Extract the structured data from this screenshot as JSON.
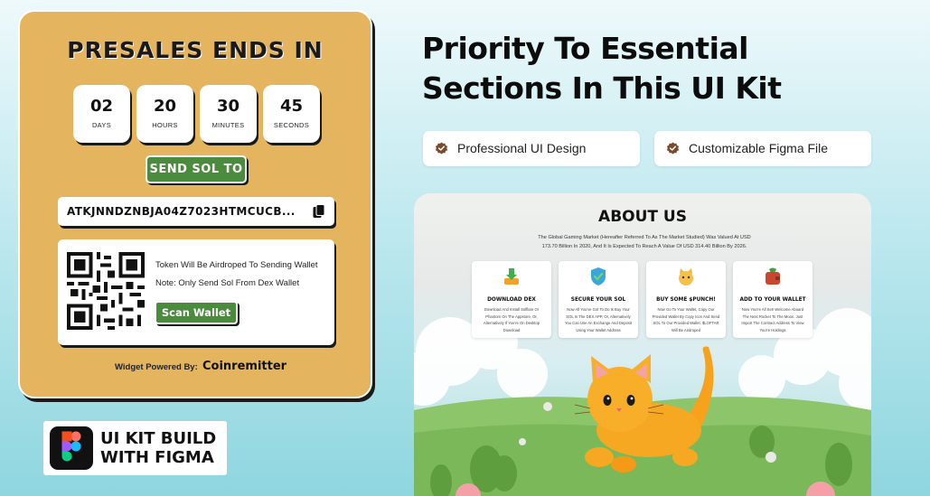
{
  "widget": {
    "title": "PRESALES ENDS IN",
    "countdown": [
      {
        "value": "02",
        "label": "DAYS"
      },
      {
        "value": "20",
        "label": "HOURS"
      },
      {
        "value": "30",
        "label": "MINUTES"
      },
      {
        "value": "45",
        "label": "SECONDS"
      }
    ],
    "send_button": "SEND SOL TO",
    "address": "ATKJNNDZNBJA04Z7023HTMCUCB...",
    "qr_note_1": "Token Will Be Airdroped To Sending Wallet",
    "qr_note_2": "Note: Only Send Sol From Dex Wallet",
    "scan_button": "Scan Wallet",
    "powered_by": "Widget Powered By:",
    "brand": "Coinremitter",
    "colors": {
      "panel": "#e5b45f",
      "button": "#4b8b3d"
    }
  },
  "figma_badge": {
    "line1": "UI KIT BUILD",
    "line2": "WITH FIGMA",
    "icon": "figma-logo-icon"
  },
  "headline": {
    "line1": "Priority To Essential",
    "line2": "Sections In This UI Kit"
  },
  "chips": [
    {
      "label": "Professional UI Design",
      "icon": "check-badge-icon"
    },
    {
      "label": "Customizable Figma File",
      "icon": "check-badge-icon"
    }
  ],
  "about": {
    "title": "ABOUT US",
    "desc": "The Global Gaming Market (Hereafter Referred To As The Market Studied) Was Valued At USD 173.70 Billion In 2020, And It Is Expected To Reach A Value Of USD 314.40 Billion By 2026.",
    "features": [
      {
        "title": "DOWNLOAD DEX",
        "text": "Download And Install Solflare Or Phantom On The Appstore, Or, Alternatively If You're On Desktop Download",
        "icon": "download-icon"
      },
      {
        "title": "SECURE YOUR SOL",
        "text": "Now All You've Got To Do Is Buy Your SOL In The DEX APP, Or, Alternatively You Can Use An Exchange And Deposit Using Your Wallet Address",
        "icon": "shield-check-icon"
      },
      {
        "title": "BUY SOME $PUNCH!",
        "text": "Now Go To Your Wallet, Copy Our Provided Wallet By Copy Icon And Send SOL To Our Provided Wallet. $LOFTAR Will Be Airdroped",
        "icon": "cat-coin-icon"
      },
      {
        "title": "ADD TO YOUR WALLET",
        "text": "Now You're All Set! Welcome Aboard The Next Rocket To The Moon. Just Import The Contract Address To View You're Holdings",
        "icon": "wallet-icon"
      }
    ]
  }
}
